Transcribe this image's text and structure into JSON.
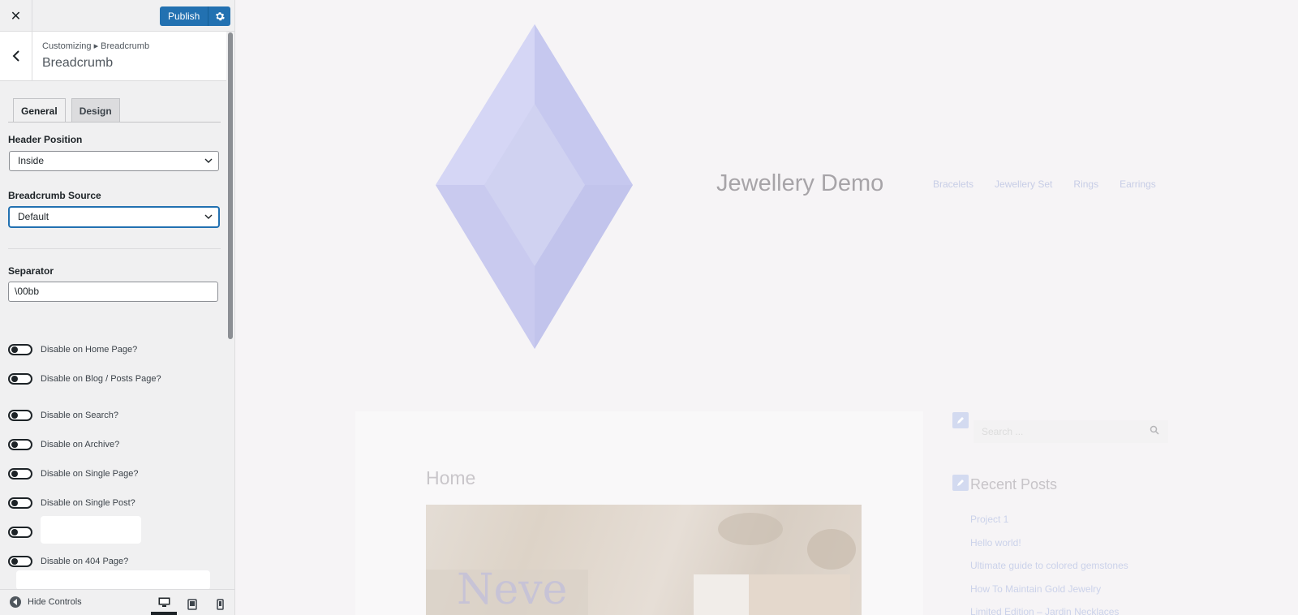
{
  "customizer": {
    "close_label": "✕",
    "publish_label": "Publish",
    "section": {
      "breadcrumb": "Customizing ▸ Breadcrumb",
      "title": "Breadcrumb"
    },
    "tabs": [
      {
        "label": "General",
        "active": true
      },
      {
        "label": "Design",
        "active": false
      }
    ],
    "header_position": {
      "label": "Header Position",
      "value": "Inside"
    },
    "breadcrumb_source": {
      "label": "Breadcrumb Source",
      "value": "Default"
    },
    "separator": {
      "label": "Separator",
      "value": "\\00bb"
    },
    "toggles": [
      {
        "label": "Disable on Home Page?",
        "on": false
      },
      {
        "label": "Disable on Blog / Posts Page?",
        "on": false
      },
      {
        "label": "Disable on Search?",
        "on": false
      },
      {
        "label": "Disable on Archive?",
        "on": false
      },
      {
        "label": "Disable on Single Page?",
        "on": false
      },
      {
        "label": "Disable on Single Post?",
        "on": false
      },
      {
        "label": "",
        "on": false
      },
      {
        "label": "Disable on 404 Page?",
        "on": false
      }
    ],
    "footer": {
      "hide_controls_label": "Hide Controls",
      "active_device": "desktop"
    }
  },
  "preview": {
    "site_title": "Jewellery Demo",
    "nav": [
      "Bracelets",
      "Jewellery Set",
      "Rings",
      "Earrings"
    ],
    "page_title": "Home",
    "hero_text": "Neve",
    "search_placeholder": "Search ...",
    "recent_posts": {
      "title": "Recent Posts",
      "items": [
        "Project 1",
        "Hello world!",
        "Ultimate guide to colored gemstones",
        "How To Maintain Gold Jewelry",
        "Limited Edition – Jardin Necklaces"
      ]
    }
  },
  "colors": {
    "accent": "#2271b1",
    "gem": "#cfd0f0",
    "link": "#cbd2ea"
  }
}
